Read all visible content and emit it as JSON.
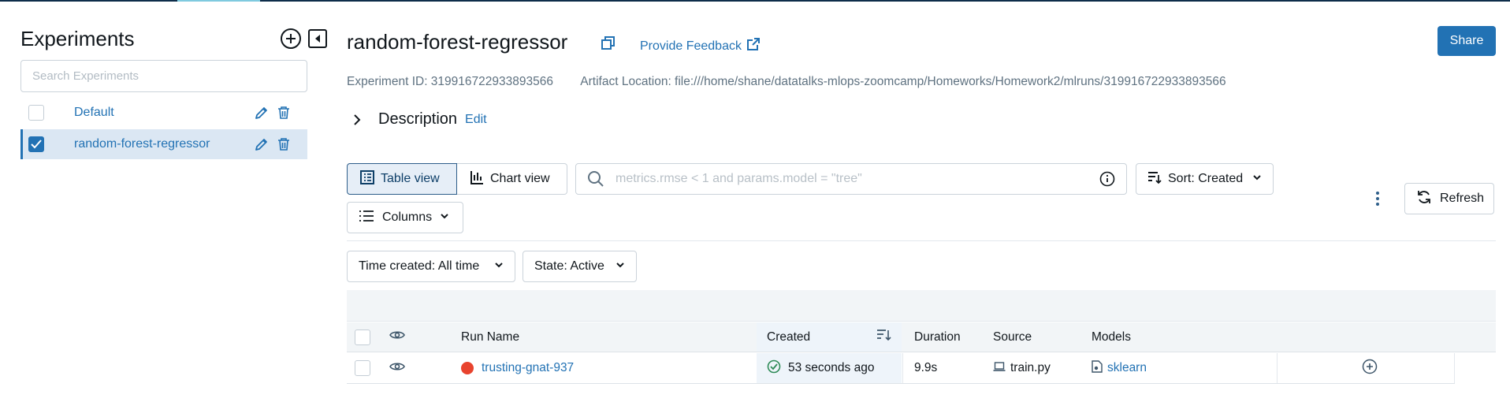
{
  "sidebar": {
    "title": "Experiments",
    "search_placeholder": "Search Experiments",
    "experiments": [
      {
        "name": "Default",
        "selected": false
      },
      {
        "name": "random-forest-regressor",
        "selected": true
      }
    ]
  },
  "header": {
    "title": "random-forest-regressor",
    "feedback_label": "Provide Feedback",
    "share_label": "Share",
    "experiment_id": "Experiment ID: 319916722933893566",
    "artifact_location": "Artifact Location: file:///home/shane/datatalks-mlops-zoomcamp/Homeworks/Homework2/mlruns/319916722933893566",
    "description_label": "Description",
    "description_edit": "Edit"
  },
  "toolbar": {
    "table_view": "Table view",
    "chart_view": "Chart view",
    "search_placeholder": "metrics.rmse < 1 and params.model = \"tree\"",
    "sort_label": "Sort: Created",
    "refresh_label": "Refresh",
    "columns_label": "Columns",
    "time_filter": "Time created: All time",
    "state_filter": "State: Active"
  },
  "table": {
    "columns": {
      "run_name": "Run Name",
      "created": "Created",
      "duration": "Duration",
      "source": "Source",
      "models": "Models"
    },
    "rows": [
      {
        "run_name": "trusting-gnat-937",
        "status_color": "#e8432e",
        "created": "53 seconds ago",
        "duration": "9.9s",
        "source": "train.py",
        "model": "sklearn"
      }
    ]
  },
  "colors": {
    "accent": "#2272b4",
    "success": "#2e8b57",
    "failed_dot": "#e8432e"
  }
}
